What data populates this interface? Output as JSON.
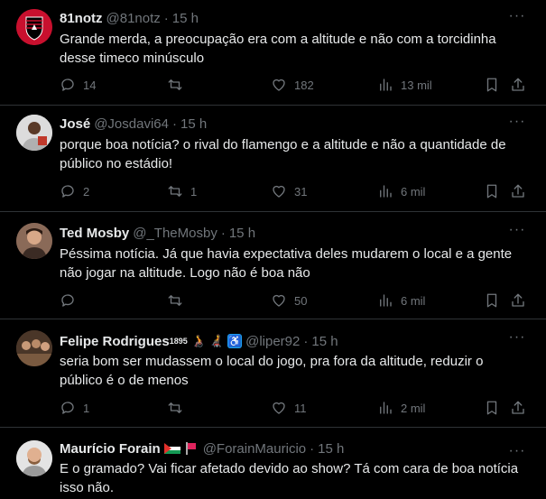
{
  "tweets": [
    {
      "name": "81notz",
      "handle": "@81notz",
      "time": "15 h",
      "text": "Grande merda, a preocupação era com a altitude e não com a torcidinha desse timeco minúsculo",
      "replies": "14",
      "retweets": "",
      "likes": "182",
      "views": "13 mil",
      "avatar": "flamengo-crest"
    },
    {
      "name": "José",
      "handle": "@Josdavi64",
      "time": "15 h",
      "text": "porque boa notícia? o rival do flamengo e a altitude e não a quantidade de público no estádio!",
      "replies": "2",
      "retweets": "1",
      "likes": "31",
      "views": "6 mil",
      "avatar": "person-photo"
    },
    {
      "name": "Ted Mosby",
      "handle": "@_TheMosby",
      "time": "15 h",
      "text": "Péssima notícia. Já que havia expectativa deles mudarem o local e a gente não jogar na altitude. Logo não é boa não",
      "replies": "",
      "retweets": "",
      "likes": "50",
      "views": "6 mil",
      "avatar": "person-photo"
    },
    {
      "name": "Felipe Rodrigues",
      "name_sup": "1895",
      "handle": "@liper92",
      "time": "15 h",
      "text": "seria bom ser mudassem o local do jogo, pra fora da altitude, reduzir o público é o de menos",
      "replies": "1",
      "retweets": "",
      "likes": "11",
      "views": "2 mil",
      "avatar": "group-photo"
    },
    {
      "name": "Maurício Forain",
      "handle": "@ForainMauricio",
      "time": "15 h",
      "text": "E o gramado? Vai ficar afetado devido ao show? Tá com cara de boa notícia isso não.",
      "avatar": "person-photo"
    }
  ],
  "icons": {
    "reply": "comment-icon",
    "retweet": "retweet-icon",
    "like": "heart-icon",
    "views": "views-chart-icon",
    "bookmark": "bookmark-icon",
    "share": "share-icon",
    "more": "more-icon"
  },
  "colors": {
    "background": "#000000",
    "text": "#e7e9ea",
    "secondary": "#71767b",
    "divider": "#2f3336",
    "accent": "#1d9bf0"
  }
}
